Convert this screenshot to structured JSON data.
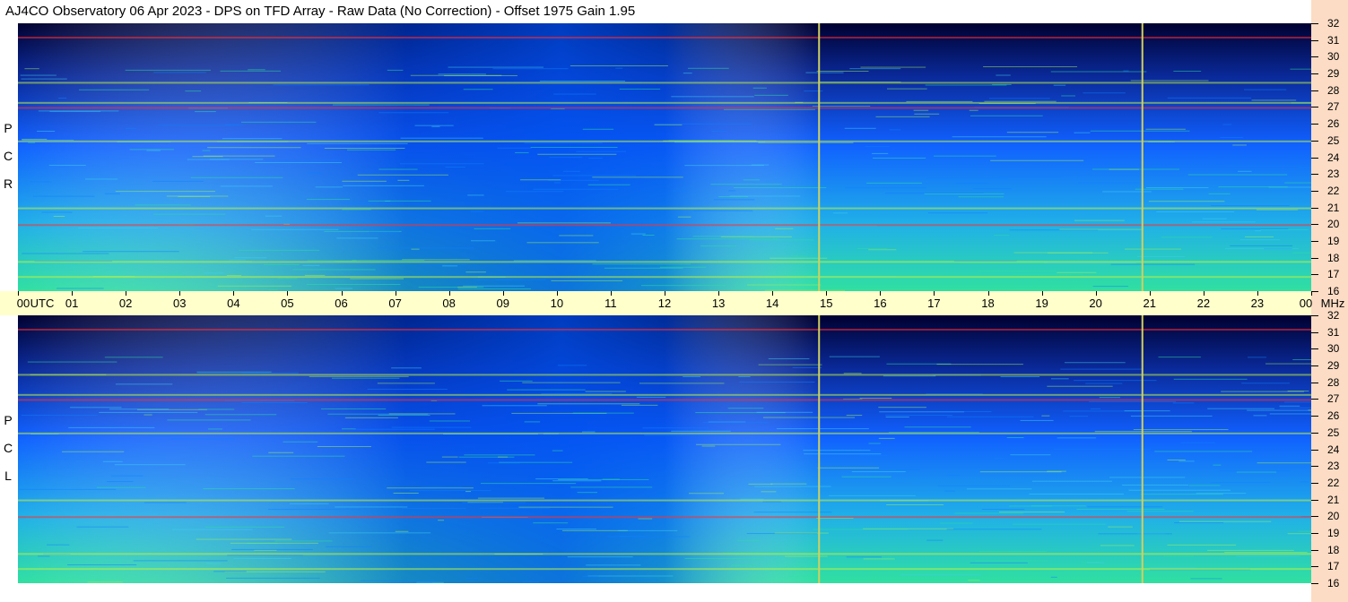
{
  "title": "AJ4CO Observatory  06 Apr 2023  -  DPS on TFD Array  -  Raw Data (No Correction)  -  Offset 1975  Gain 1.95",
  "panels": [
    {
      "label_letters": [
        "R",
        "C",
        "P"
      ]
    },
    {
      "label_letters": [
        "L",
        "C",
        "P"
      ]
    }
  ],
  "chart_data": {
    "type": "heatmap",
    "title": "AJ4CO Observatory  06 Apr 2023  -  DPS on TFD Array  -  Raw Data (No Correction)  -  Offset 1975  Gain 1.95",
    "xlabel": "UTC",
    "ylabel": "MHz",
    "x_unit_label": "UTC",
    "y_unit_label": "MHz",
    "xlim": [
      0,
      24
    ],
    "ylim": [
      16,
      32
    ],
    "x_ticks": [
      "00",
      "01",
      "02",
      "03",
      "04",
      "05",
      "06",
      "07",
      "08",
      "09",
      "10",
      "11",
      "12",
      "13",
      "14",
      "15",
      "16",
      "17",
      "18",
      "19",
      "20",
      "21",
      "22",
      "23",
      "00"
    ],
    "y_ticks": [
      32,
      31,
      30,
      29,
      28,
      27,
      26,
      25,
      24,
      23,
      22,
      21,
      20,
      19,
      18,
      17,
      16
    ],
    "series": [
      {
        "name": "RCP"
      },
      {
        "name": "LCP"
      }
    ],
    "bright_lines_mhz": [
      31.2,
      28.5,
      27.3,
      27.0,
      25.0,
      21.0,
      20.0,
      17.8,
      16.9
    ],
    "vertical_markers_utc": [
      14.85,
      20.85
    ],
    "colors": {
      "low": "#000030",
      "mid": "#1060ff",
      "high": "#30e0a0",
      "peak": "#ff3030",
      "strip": "#ffffcc",
      "right_strip": "#fcdcc4"
    }
  }
}
